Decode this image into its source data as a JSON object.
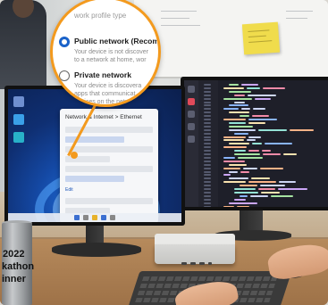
{
  "lens": {
    "heading": "work profile type",
    "options": [
      {
        "title": "Public network (Recom",
        "desc": [
          "Your device is not discover",
          "to a network at home, wor"
        ],
        "selected": true
      },
      {
        "title": "Private network",
        "desc": [
          "Your device is discovera",
          "apps that communicat",
          "devices on the netw"
        ],
        "selected": false
      }
    ]
  },
  "settings_window": {
    "title": "Network & Internet > Ethernet",
    "link_label": "Edit"
  },
  "cup": {
    "lines": [
      "2022",
      "kathon",
      "inner"
    ]
  },
  "colors": {
    "accent": "#f39a1e",
    "selected_radio": "#1a62c9",
    "sticky_note": "#f0dc4c"
  }
}
